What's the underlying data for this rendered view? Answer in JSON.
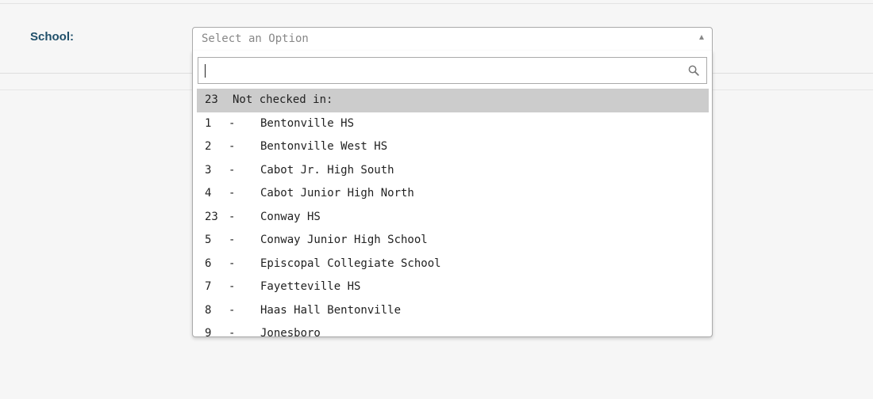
{
  "form": {
    "label": "School:"
  },
  "select": {
    "placeholder": "Select an Option",
    "arrow_icon": "triangle-up-icon"
  },
  "dropdown": {
    "search": {
      "value": "",
      "icon": "search-icon"
    },
    "group": {
      "count": "23",
      "label": "Not checked in:"
    },
    "options": [
      {
        "num": "1",
        "dash": "-",
        "name": "Bentonville HS"
      },
      {
        "num": "2",
        "dash": "-",
        "name": "Bentonville West HS"
      },
      {
        "num": "3",
        "dash": "-",
        "name": "Cabot Jr. High South"
      },
      {
        "num": "4",
        "dash": "-",
        "name": "Cabot Junior High North"
      },
      {
        "num": "23",
        "dash": "-",
        "name": "Conway HS"
      },
      {
        "num": "5",
        "dash": "-",
        "name": "Conway Junior High School"
      },
      {
        "num": "6",
        "dash": "-",
        "name": "Episcopal Collegiate School"
      },
      {
        "num": "7",
        "dash": "-",
        "name": "Fayetteville HS"
      },
      {
        "num": "8",
        "dash": "-",
        "name": "Haas Hall Bentonville"
      },
      {
        "num": "9",
        "dash": "-",
        "name": "Jonesboro"
      }
    ]
  },
  "colors": {
    "label": "#1f4f6a",
    "group_highlight": "#cccccc",
    "background": "#f6f6f6"
  }
}
